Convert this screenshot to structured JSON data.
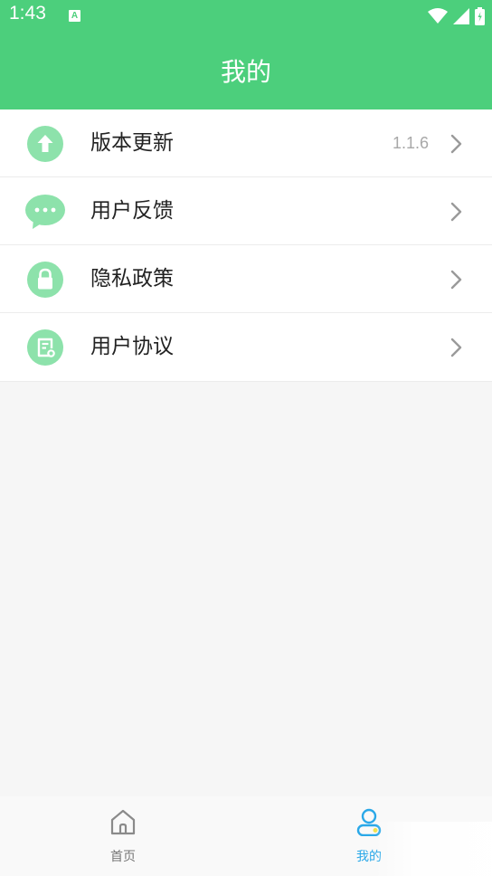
{
  "status_bar": {
    "time": "1:43",
    "notification_letter": "A"
  },
  "header": {
    "title": "我的"
  },
  "menu": {
    "items": [
      {
        "label": "版本更新",
        "value": "1.1.6",
        "icon": "arrow-up-icon"
      },
      {
        "label": "用户反馈",
        "icon": "chat-bubble-icon"
      },
      {
        "label": "隐私政策",
        "icon": "lock-icon"
      },
      {
        "label": "用户协议",
        "icon": "document-icon"
      }
    ]
  },
  "tabs": [
    {
      "label": "首页",
      "icon": "home-icon",
      "active": false
    },
    {
      "label": "我的",
      "icon": "user-icon",
      "active": true
    }
  ],
  "colors": {
    "primary_green": "#4ccf7c",
    "icon_green": "#8de2ab",
    "active_tab": "#2aa8e8",
    "inactive_tab": "#777777"
  }
}
